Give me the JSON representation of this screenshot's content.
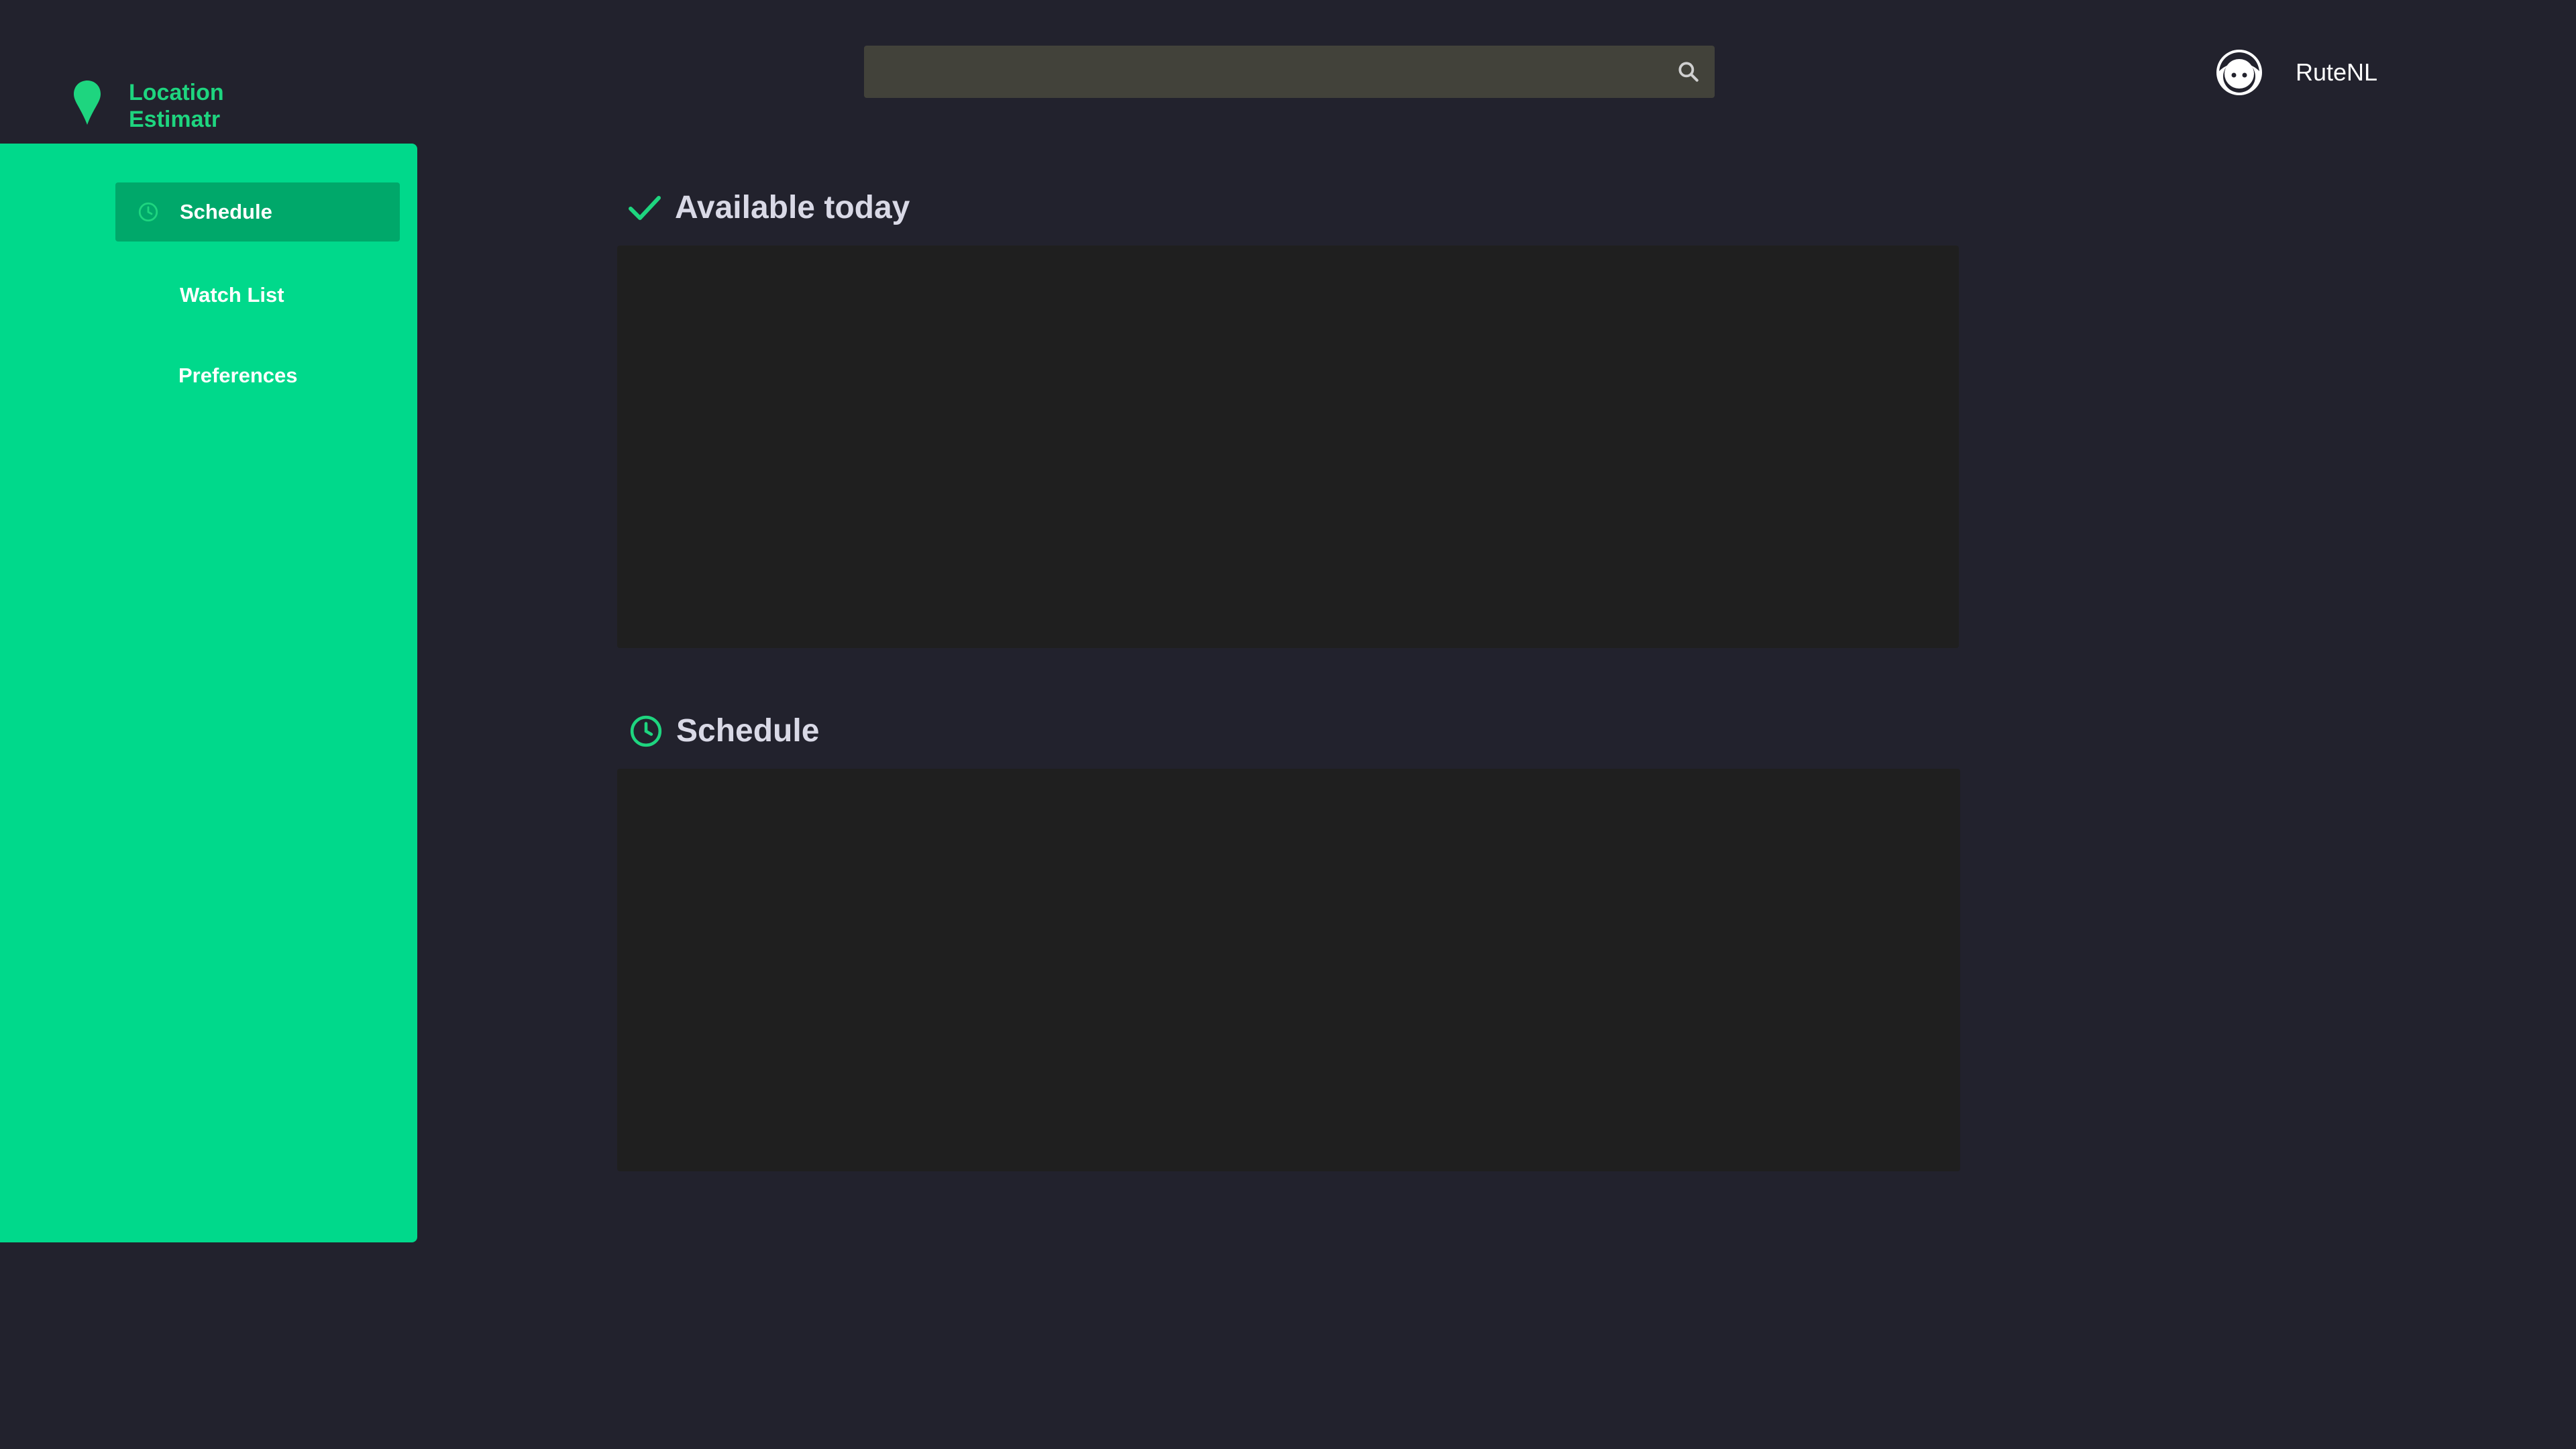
{
  "app": {
    "name": "Location Estimatr",
    "accent_color": "#00d98b",
    "logo_color": "#1ed57f"
  },
  "sidebar": {
    "items": [
      {
        "label": "Schedule",
        "icon": "clock-icon",
        "active": true
      },
      {
        "label": "Watch List",
        "icon": null,
        "active": false
      },
      {
        "label": "Preferences",
        "icon": null,
        "active": false
      }
    ]
  },
  "search": {
    "placeholder": "",
    "value": "",
    "icon": "search-icon"
  },
  "user": {
    "name": "RuteNL",
    "avatar_icon": "face-avatar-icon"
  },
  "sections": {
    "available": {
      "title": "Available today",
      "icon": "checkmark-icon"
    },
    "schedule": {
      "title": "Schedule",
      "icon": "clock-icon"
    }
  }
}
